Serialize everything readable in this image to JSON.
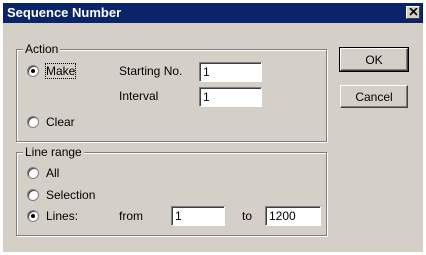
{
  "window": {
    "title": "Sequence Number"
  },
  "action_group": {
    "legend": "Action",
    "make_label": "Make",
    "starting_no_label": "Starting No.",
    "starting_no_value": "1",
    "interval_label": "Interval",
    "interval_value": "1",
    "clear_label": "Clear",
    "selected": "Make"
  },
  "line_range_group": {
    "legend": "Line range",
    "all_label": "All",
    "selection_label": "Selection",
    "lines_label": "Lines:",
    "from_label": "from",
    "from_value": "1",
    "to_label": "to",
    "to_value": "1200",
    "selected": "Lines:"
  },
  "buttons": {
    "ok": "OK",
    "cancel": "Cancel"
  }
}
